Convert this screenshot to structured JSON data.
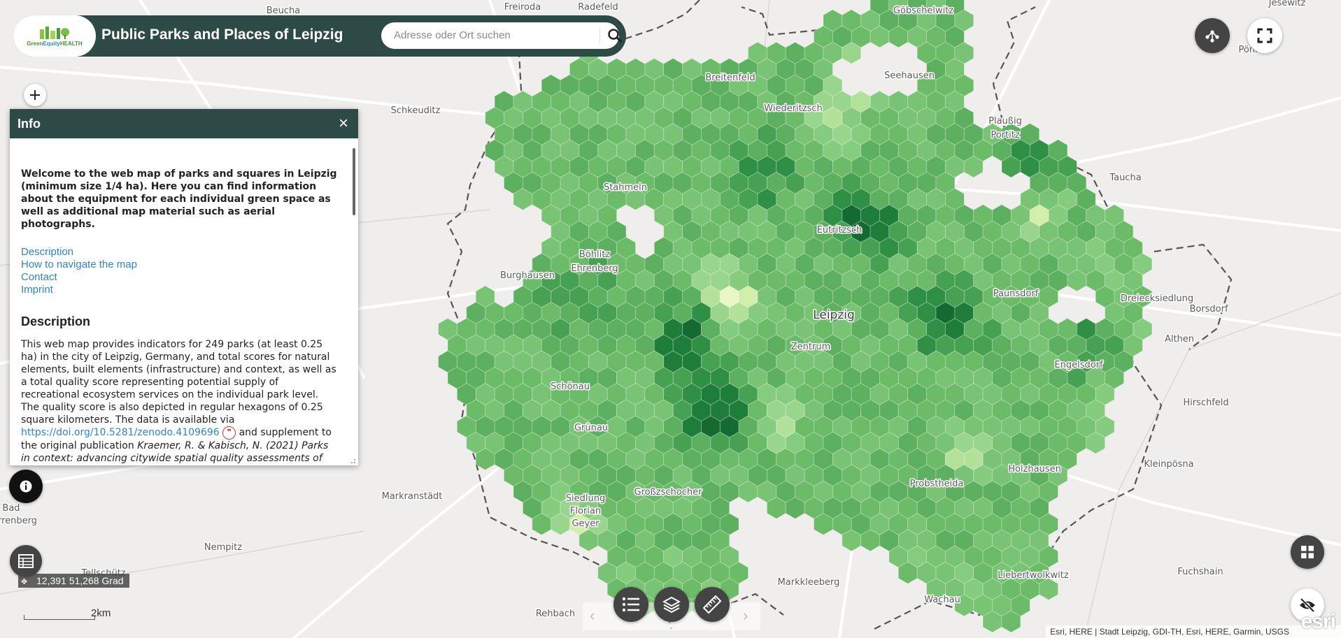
{
  "header": {
    "title": "Public Parks and Places of Leipzig",
    "logo_text_green": "Green",
    "logo_text_blue": "Equity",
    "logo_text_rest": "HEALTH",
    "search_placeholder": "Adresse oder Ort suchen"
  },
  "info_panel": {
    "title": "Info",
    "close": "×",
    "welcome": "Welcome to the web map of parks and squares in Leipzig (minimum size 1/4 ha). Here you can find information about the equipment for each individual green space as well as additional map material such as aerial photographs.",
    "links": [
      "Description",
      "How to navigate the map",
      "Contact",
      "Imprint"
    ],
    "description_heading": "Description",
    "description_text": "This web map provides indicators for 249 parks (at least 0.25 ha) in the city of Leipzig, Germany, and total scores for natural elements, built elements (infrastructure) and context, as well as a total quality score representing potential supply of recreational ecosystem services on the individual park level. The quality score is also depicted in regular hexagons of 0.25 square kilometers. The data is available via",
    "doi_link": "https://doi.org/10.5281/zenodo.4109696",
    "description_text_2": "and supplement to the original publication",
    "citation": "Kraemer, R. & Kabisch, N. (2021) Parks in context: advancing citywide spatial quality assessments of"
  },
  "coordinates": "12,391 51,268 Grad",
  "scale_label": "2km",
  "attribution": "Esri, HERE | Stadt Leipzig, GDI-TH, Esri, HERE, Garmin, USGS",
  "esri_logo": "esri",
  "icons": {
    "zoom_in": "plus-icon",
    "info": "info-icon",
    "table": "table-icon",
    "share": "share-icon",
    "fullscreen": "fullscreen-icon",
    "grid": "apps-grid-icon",
    "visibility": "eye-off-icon",
    "legend": "legend-list-icon",
    "layers": "layers-icon",
    "measure": "ruler-icon"
  },
  "colors": {
    "header_bg": "#2e4a47",
    "link": "#2b86c7",
    "hex_palette": [
      "#eaf7c4",
      "#d3edab",
      "#b4e19a",
      "#99d58c",
      "#86cc7f",
      "#79c374",
      "#6cbb69",
      "#5cb05f",
      "#46a153",
      "#2f8f45",
      "#1f7d3a",
      "#146a31"
    ]
  },
  "map_labels": [
    {
      "name": "Beucha",
      "text": "Beucha"
    },
    {
      "name": "Freiroda",
      "text": "Freiroda"
    },
    {
      "name": "Radefeld",
      "text": "Radefeld"
    },
    {
      "name": "Goebschelwitz",
      "text": "Göbschelwitz"
    },
    {
      "name": "Jesewitz",
      "text": "Jesewitz"
    },
    {
      "name": "Ponitz",
      "text": "Pönitz"
    },
    {
      "name": "Breitenfeld",
      "text": "Breitenfeld"
    },
    {
      "name": "Seehausen",
      "text": "Seehausen"
    },
    {
      "name": "Schkeuditz",
      "text": "Schkeuditz"
    },
    {
      "name": "Wiederitzsch",
      "text": "Wiederitzsch"
    },
    {
      "name": "Plaussig",
      "text": "Plaußig"
    },
    {
      "name": "Portitz",
      "text": "Portitz"
    },
    {
      "name": "Taucha",
      "text": "Taucha"
    },
    {
      "name": "Stahmeln",
      "text": "Stahmeln"
    },
    {
      "name": "Eutritzsch",
      "text": "Eutritzsch"
    },
    {
      "name": "Boehlitz",
      "text": "Böhlitz"
    },
    {
      "name": "Ehrenberg",
      "text": "Ehrenberg"
    },
    {
      "name": "Burghausen",
      "text": "Burghausen"
    },
    {
      "name": "Paunsdorf",
      "text": "Paunsdorf"
    },
    {
      "name": "Dreiecksiedlung",
      "text": "Dreiecksiedlung"
    },
    {
      "name": "Borsdorf",
      "text": "Borsdorf"
    },
    {
      "name": "Leipzig",
      "text": "Leipzig"
    },
    {
      "name": "Zentrum",
      "text": "Zentrum"
    },
    {
      "name": "Althen",
      "text": "Althen"
    },
    {
      "name": "Engelsdorf",
      "text": "Engelsdorf"
    },
    {
      "name": "Schoenau",
      "text": "Schönau"
    },
    {
      "name": "Hirschfeld",
      "text": "Hirschfeld"
    },
    {
      "name": "Gruenau",
      "text": "Grünau"
    },
    {
      "name": "Holzhausen",
      "text": "Holzhausen"
    },
    {
      "name": "Kleinpoesna",
      "text": "Kleinpösna"
    },
    {
      "name": "Probstheida",
      "text": "Probstheida"
    },
    {
      "name": "Markranstaedt",
      "text": "Markranstädt"
    },
    {
      "name": "Grossschocher",
      "text": "Großzschocher"
    },
    {
      "name": "Siedlung",
      "text": "Siedlung"
    },
    {
      "name": "Florian",
      "text": "Florian"
    },
    {
      "name": "Geyer",
      "text": "Geyer"
    },
    {
      "name": "Bad",
      "text": "Bad"
    },
    {
      "name": "Duerrenberg",
      "text": "rrenberg"
    },
    {
      "name": "Nempitz",
      "text": "Nempitz"
    },
    {
      "name": "Fuchshain",
      "text": "Fuchshain"
    },
    {
      "name": "Markkleeberg",
      "text": "Markkleeberg"
    },
    {
      "name": "Liebertwolkwitz",
      "text": "Liebertwolkwitz"
    },
    {
      "name": "Wachau",
      "text": "Wachau"
    },
    {
      "name": "Rehbach",
      "text": "Rehbach"
    },
    {
      "name": "Tellschuetz",
      "text": "Tellschütz"
    }
  ]
}
